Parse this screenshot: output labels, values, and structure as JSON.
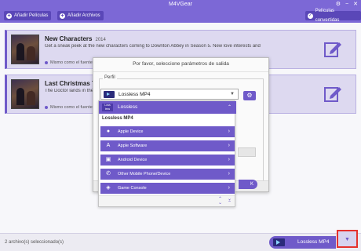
{
  "app": {
    "title": "M4VGear",
    "window_controls": {
      "settings": "⚙",
      "minimize": "−",
      "close": "✕"
    }
  },
  "toolbar": {
    "add_movies": "Añadir Películas",
    "add_files": "Añadir Archivos",
    "converted": "Películas convertidas"
  },
  "items": [
    {
      "title": "New Characters",
      "year": "2014",
      "desc": "Get a sneak peek at the new characters coming to Downton Abbey in Season 5. New love interests and",
      "status": "Mismo como el fuente"
    },
    {
      "title": "Last Christmas Trailer",
      "year": "",
      "desc": "The Doctor lands in the Newman",
      "status": "Mismo como el fuente"
    }
  ],
  "dialog": {
    "title": "Por favor, seleccione parámetros de salida",
    "profile_label": "Perfil",
    "selected_profile": "Lossless MP4",
    "ok_partial": "K"
  },
  "dropdown": {
    "header_badge": "Loss less",
    "header": "Lossless",
    "subheader": "Lossless MP4",
    "items": [
      {
        "icon": "apple-icon",
        "label": "Apple Device"
      },
      {
        "icon": "app-store-icon",
        "label": "Apple Software"
      },
      {
        "icon": "android-icon",
        "label": "Android Device"
      },
      {
        "icon": "phone-icon",
        "label": "Other Mobile Phone/Device"
      },
      {
        "icon": "gamepad-icon",
        "label": "Game Console"
      }
    ]
  },
  "bottom": {
    "selected_count": "2 archivo(s) seleccionado(s)",
    "output_format": "Lossless MP4"
  },
  "colors": {
    "accent": "#6f5ac9",
    "titlebar": "#7c68d6",
    "highlight_border": "#e5322d"
  }
}
